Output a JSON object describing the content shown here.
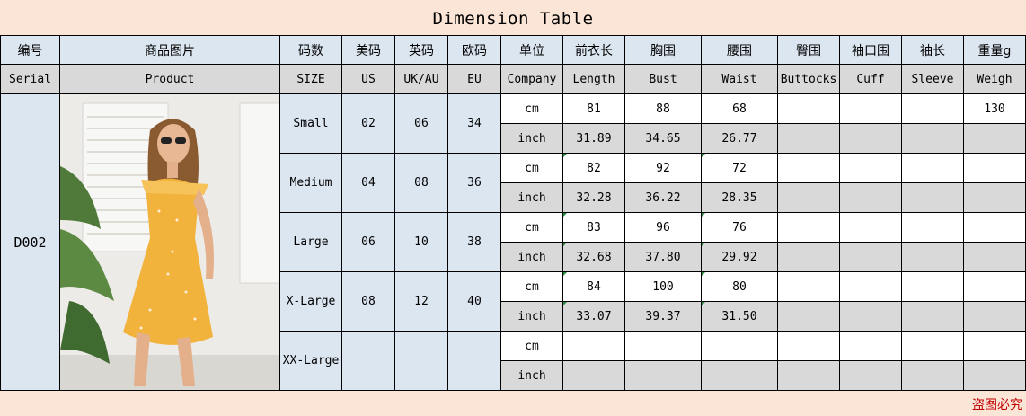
{
  "title": "Dimension Table",
  "header_cn": [
    "编号",
    "商品图片",
    "码数",
    "美码",
    "英码",
    "欧码",
    "单位",
    "前衣长",
    "胸围",
    "腰围",
    "臀围",
    "袖口围",
    "袖长",
    "重量g"
  ],
  "header_en": [
    "Serial",
    "Product",
    "SIZE",
    "US",
    "UK/AU",
    "EU",
    "Company",
    "Length",
    "Bust",
    "Waist",
    "Buttocks",
    "Cuff",
    "Sleeve",
    "Weigh"
  ],
  "serial": "D002",
  "sizes": [
    {
      "name": "Small",
      "us": "02",
      "uk": "06",
      "eu": "34",
      "cm": {
        "unit": "cm",
        "length": "81",
        "bust": "88",
        "waist": "68",
        "weight": "130"
      },
      "inch": {
        "unit": "inch",
        "length": "31.89",
        "bust": "34.65",
        "waist": "26.77"
      }
    },
    {
      "name": "Medium",
      "us": "04",
      "uk": "08",
      "eu": "36",
      "cm": {
        "unit": "cm",
        "length": "82",
        "bust": "92",
        "waist": "72"
      },
      "inch": {
        "unit": "inch",
        "length": "32.28",
        "bust": "36.22",
        "waist": "28.35"
      }
    },
    {
      "name": "Large",
      "us": "06",
      "uk": "10",
      "eu": "38",
      "cm": {
        "unit": "cm",
        "length": "83",
        "bust": "96",
        "waist": "76"
      },
      "inch": {
        "unit": "inch",
        "length": "32.68",
        "bust": "37.80",
        "waist": "29.92"
      }
    },
    {
      "name": "X-Large",
      "us": "08",
      "uk": "12",
      "eu": "40",
      "cm": {
        "unit": "cm",
        "length": "84",
        "bust": "100",
        "waist": "80"
      },
      "inch": {
        "unit": "inch",
        "length": "33.07",
        "bust": "39.37",
        "waist": "31.50"
      }
    },
    {
      "name": "XX-Large",
      "us": "",
      "uk": "",
      "eu": "",
      "cm": {
        "unit": "cm",
        "length": "",
        "bust": "",
        "waist": ""
      },
      "inch": {
        "unit": "inch",
        "length": "",
        "bust": "",
        "waist": ""
      }
    }
  ],
  "watermark": "盗图必究",
  "colors": {
    "header_blue": "#dce6f1",
    "grey": "#d9d9d9",
    "peach": "#fbe5d6",
    "marker": "#1f8a3a",
    "watermark": "#c00000",
    "dress": "#f2b33d"
  }
}
